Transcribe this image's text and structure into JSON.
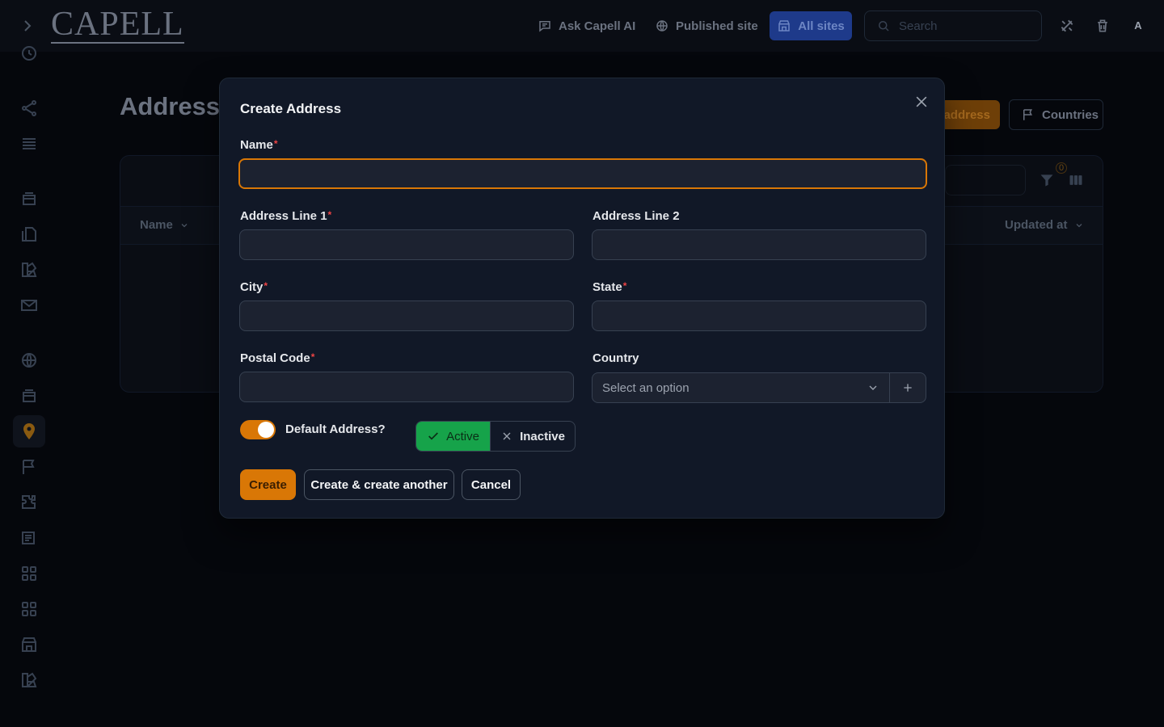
{
  "topbar": {
    "logo": "CAPELL",
    "ask_ai": "Ask Capell AI",
    "published_site": "Published site",
    "all_sites": "All sites",
    "search_placeholder": "Search",
    "avatar_initial": "A"
  },
  "page": {
    "title": "Addresses",
    "new_button": "New address",
    "new_button_visible": "address",
    "countries_button": "Countries",
    "table": {
      "columns": [
        "Name",
        "Updated at"
      ],
      "filter_count": "0"
    }
  },
  "modal": {
    "title": "Create Address",
    "fields": {
      "name": {
        "label": "Name",
        "value": ""
      },
      "address_line_1": {
        "label": "Address Line 1",
        "value": ""
      },
      "address_line_2": {
        "label": "Address Line 2",
        "value": ""
      },
      "city": {
        "label": "City",
        "value": ""
      },
      "state": {
        "label": "State",
        "value": ""
      },
      "postal_code": {
        "label": "Postal Code",
        "value": ""
      },
      "country": {
        "label": "Country",
        "placeholder": "Select an option"
      }
    },
    "default_address": {
      "label": "Default Address?",
      "on": true
    },
    "status": {
      "active": "Active",
      "inactive": "Inactive",
      "selected": "Active"
    },
    "buttons": {
      "create": "Create",
      "create_another": "Create & create another",
      "cancel": "Cancel"
    }
  },
  "colors": {
    "accent": "#d97706",
    "success": "#16a34a",
    "modal_bg": "#111827",
    "required": "#ef4444"
  }
}
